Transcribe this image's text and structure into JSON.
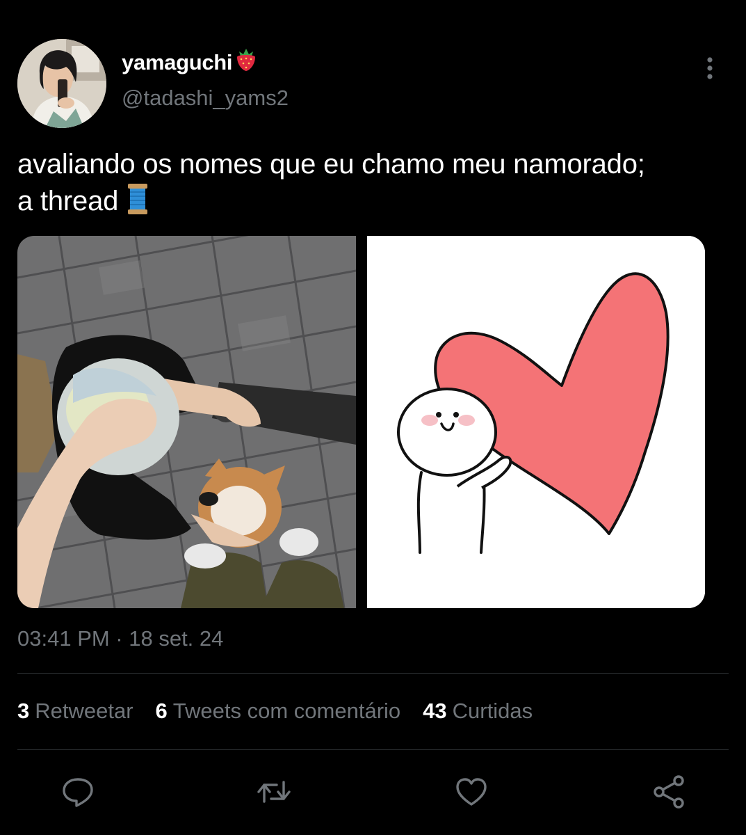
{
  "author": {
    "display_name": "yamaguchi",
    "name_emoji": "strawberry-emoji",
    "handle": "@tadashi_yams2"
  },
  "tweet": {
    "text_line1": "avaliando os nomes que eu chamo meu namorado;",
    "text_line2": "a thread",
    "text_emoji": "spool-of-thread-emoji",
    "timestamp": "03:41 PM · 18 set. 24"
  },
  "stats": {
    "retweets_count": "3",
    "retweets_label": "Retweetar",
    "quotes_count": "6",
    "quotes_label": "Tweets com comentário",
    "likes_count": "43",
    "likes_label": "Curtidas"
  },
  "actions": [
    "reply-icon",
    "retweet-icon",
    "like-icon",
    "share-icon"
  ],
  "colors": {
    "background": "#000000",
    "text": "#ffffff",
    "secondary_text": "#71767b",
    "divider": "#2f3336",
    "heart_fill": "#f47376"
  }
}
